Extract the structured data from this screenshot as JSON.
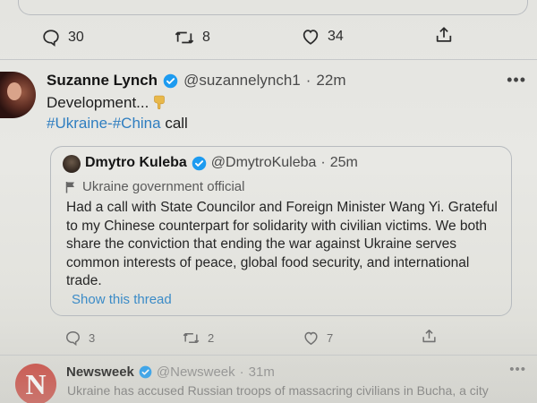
{
  "top_tweet": {
    "reply_count": "30",
    "retweet_count": "8",
    "like_count": "34"
  },
  "tweet": {
    "author_name": "Suzanne Lynch",
    "author_handle": "@suzannelynch1",
    "separator": "·",
    "time": "22m",
    "more_label": "•••",
    "text_line1": "Development...",
    "hashtag1": "#Ukraine",
    "dash": "-",
    "hashtag2": "#China",
    "text_tail": " call",
    "quote": {
      "author_name": "Dmytro Kuleba",
      "author_handle": "@DmytroKuleba",
      "separator": "·",
      "time": "25m",
      "label": "Ukraine government official",
      "text": "Had a call with State Councilor and Foreign Minister Wang Yi. Grateful to my Chinese counterpart for solidarity with civilian victims. We both share the conviction that ending the war against Ukraine serves common interests of peace, global food security, and international trade.",
      "show_thread": "Show this thread"
    },
    "reply_count": "3",
    "retweet_count": "2",
    "like_count": "7"
  },
  "next_tweet": {
    "author_name": "Newsweek",
    "author_handle": "@Newsweek",
    "separator": "·",
    "time": "31m",
    "logo_letter": "N",
    "more_label": "•••",
    "text": "Ukraine has accused Russian troops of massacring civilians in Bucha, a city"
  },
  "colors": {
    "link_blue": "#2f7ec0",
    "verified_blue": "#1d9bf0",
    "newsweek_red": "#c9463d"
  },
  "icons": {
    "reply": "reply-icon",
    "retweet": "retweet-icon",
    "like": "heart-icon",
    "share": "share-icon",
    "verified": "verified-badge-icon",
    "government": "flag-icon",
    "pointing": "pointing-down-emoji-icon"
  }
}
